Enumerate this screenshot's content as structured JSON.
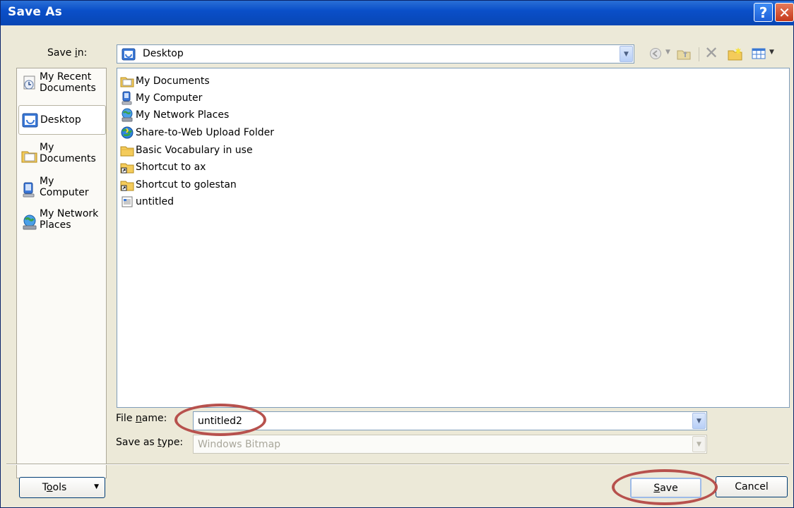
{
  "window": {
    "title": "Save As"
  },
  "toolbar": {
    "save_in_label": "Save in:",
    "location": "Desktop"
  },
  "places": [
    {
      "label1": "My Recent",
      "label2": "Documents",
      "icon": "recent-documents-icon"
    },
    {
      "label1": "Desktop",
      "label2": "",
      "icon": "desktop-icon"
    },
    {
      "label1": "My",
      "label2": "Documents",
      "icon": "my-documents-icon"
    },
    {
      "label1": "My",
      "label2": "Computer",
      "icon": "my-computer-icon"
    },
    {
      "label1": "My Network",
      "label2": "Places",
      "icon": "network-places-icon"
    }
  ],
  "files": [
    {
      "name": "My Documents",
      "icon": "my-documents-icon"
    },
    {
      "name": "My Computer",
      "icon": "my-computer-icon"
    },
    {
      "name": "My Network Places",
      "icon": "network-places-icon"
    },
    {
      "name": "Share-to-Web Upload Folder",
      "icon": "web-folder-icon"
    },
    {
      "name": "Basic Vocabulary in use",
      "icon": "folder-icon"
    },
    {
      "name": "Shortcut to ax",
      "icon": "folder-shortcut-icon"
    },
    {
      "name": "Shortcut to golestan",
      "icon": "folder-shortcut-icon"
    },
    {
      "name": "untitled",
      "icon": "bitmap-file-icon"
    }
  ],
  "form": {
    "file_name_label": "File name:",
    "file_name_value": "untitled2",
    "save_type_label": "Save as type:",
    "save_type_value": "Windows Bitmap"
  },
  "buttons": {
    "tools": "Tools",
    "save": "Save",
    "cancel": "Cancel"
  },
  "colors": {
    "highlight_oval": "#b7514d",
    "title_bar": "#0a4fc9"
  }
}
